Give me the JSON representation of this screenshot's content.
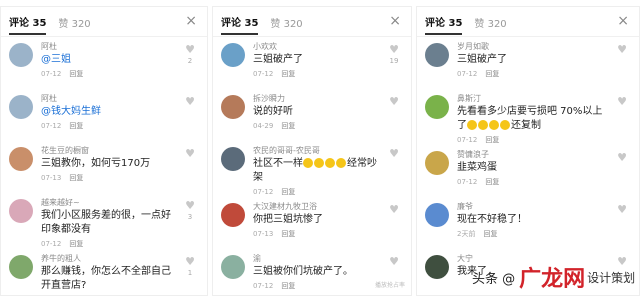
{
  "panels": [
    {
      "comments_tab": "评论 35",
      "likes_tab": "赞 320",
      "close_glyph": "×",
      "comments": [
        {
          "user": "阿杜",
          "mention": "@三姐",
          "text": "",
          "date": "07-12",
          "reply": "回复",
          "likes": "2",
          "avatar_color": "#9bb3c9"
        },
        {
          "user": "阿杜",
          "mention": "@钱大妈生鲜",
          "text": "",
          "date": "07-12",
          "reply": "回复",
          "likes": "",
          "avatar_color": "#9bb3c9"
        },
        {
          "user": "花生豆的橱窗",
          "mention": "",
          "text": "三姐教你，如何亏170万",
          "date": "07-13",
          "reply": "回复",
          "likes": "",
          "avatar_color": "#c98f6a"
        },
        {
          "user": "越来越好~",
          "mention": "",
          "text": "我们小区服务差的很，一点好印象都没有",
          "date": "07-12",
          "reply": "回复",
          "likes": "3",
          "avatar_color": "#d9a8b8"
        },
        {
          "user": "养牛的粗人",
          "mention": "",
          "text": "那么赚钱，你怎么不全部自己开直营店?",
          "date": "",
          "reply": "",
          "likes": "1",
          "avatar_color": "#7fa86b"
        }
      ]
    },
    {
      "comments_tab": "评论 35",
      "likes_tab": "赞 320",
      "close_glyph": "×",
      "comments": [
        {
          "user": "小欢欢",
          "text": "三姐破产了",
          "date": "07-12",
          "reply": "回复",
          "likes": "19",
          "avatar_color": "#6aa0c8"
        },
        {
          "user": "拆沙瞬力",
          "text": "说的好听",
          "date": "04-29",
          "reply": "回复",
          "likes": "",
          "avatar_color": "#b57a5a"
        },
        {
          "user": "农民的哥哥-农民哥",
          "text": "社区不一样",
          "emoji_count": 4,
          "text_after": "经常吵架",
          "date": "07-12",
          "reply": "回复",
          "likes": "",
          "avatar_color": "#5b6b7a"
        },
        {
          "user": "大汉建材九牧卫浴",
          "text": "你把三姐坑惨了",
          "date": "07-13",
          "reply": "回复",
          "likes": "",
          "avatar_color": "#c04a3a"
        },
        {
          "user": "渝",
          "text": "三姐被你们坑破产了。",
          "date": "07-12",
          "reply": "回复",
          "likes": "",
          "avatar_color": "#8ab0a0"
        }
      ],
      "watermark": "播放抢占率"
    },
    {
      "comments_tab": "评论 35",
      "likes_tab": "赞 320",
      "close_glyph": "×",
      "comments": [
        {
          "user": "岁月如歌",
          "text": "三姐破产了",
          "date": "07-12",
          "reply": "回复",
          "likes": "",
          "avatar_color": "#6b7f8f"
        },
        {
          "user": "鼻斯汀",
          "text": "先看看多少店要亏损吧 70%以上了",
          "emoji_count": 4,
          "text_after": "还复制",
          "date": "07-12",
          "reply": "回复",
          "likes": "",
          "avatar_color": "#7ab24a"
        },
        {
          "user": "赞慵浪子",
          "text": "韭菜鸡蛋",
          "date": "07-12",
          "reply": "回复",
          "likes": "",
          "avatar_color": "#c9a64a"
        },
        {
          "user": "廉爷",
          "text": "现在不好稳了！",
          "date": "2天前",
          "reply": "回复",
          "likes": "",
          "avatar_color": "#5a8bd0"
        },
        {
          "user": "大宁",
          "text": "我来了",
          "date": "",
          "reply": "",
          "likes": "",
          "avatar_color": "#3f4f3f"
        }
      ]
    }
  ],
  "brand": {
    "prefix": "头条 @",
    "logo": "广龙网",
    "suffix": "设计策划"
  }
}
